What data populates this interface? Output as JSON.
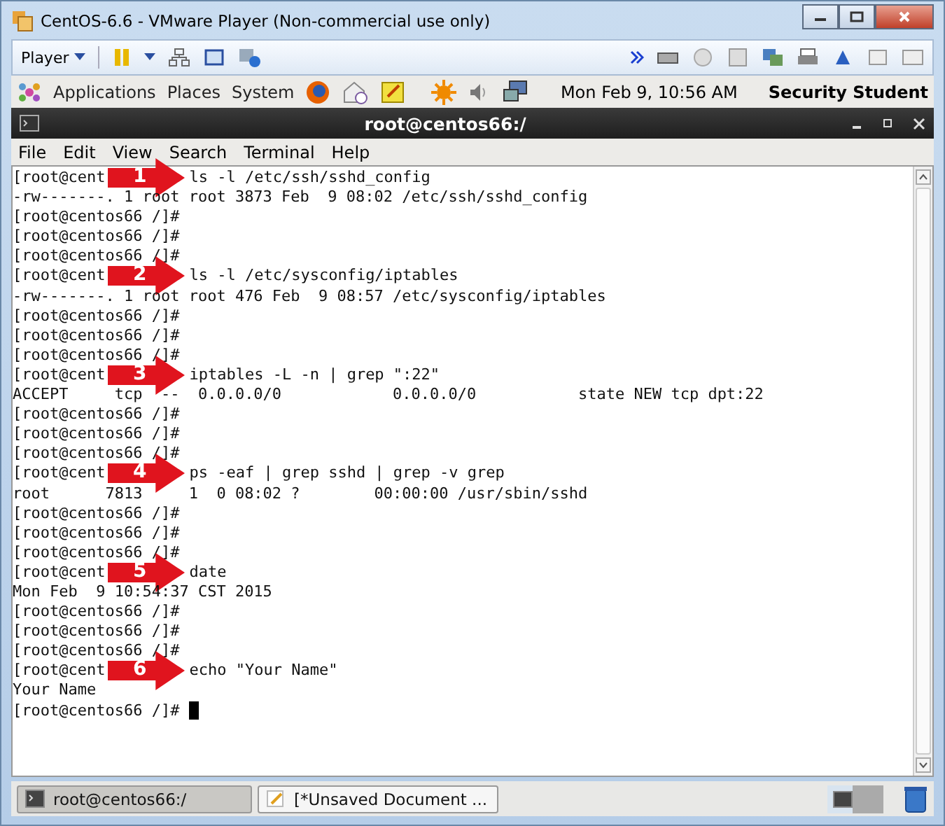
{
  "window": {
    "title": "CentOS-6.6 - VMware Player (Non-commercial use only)"
  },
  "player_toolbar": {
    "menu_label": "Player"
  },
  "panel": {
    "menus": [
      "Applications",
      "Places",
      "System"
    ],
    "clock": "Mon Feb  9, 10:56 AM",
    "user": "Security Student"
  },
  "terminal": {
    "title": "root@centos66:/",
    "menu": [
      "File",
      "Edit",
      "View",
      "Search",
      "Terminal",
      "Help"
    ],
    "lines": [
      {
        "kind": "marked",
        "prefix": "[root@cent",
        "marker": "1",
        "text": "ls -l /etc/ssh/sshd_config"
      },
      {
        "kind": "plain",
        "text": "-rw-------. 1 root root 3873 Feb  9 08:02 /etc/ssh/sshd_config"
      },
      {
        "kind": "plain",
        "text": "[root@centos66 /]#"
      },
      {
        "kind": "plain",
        "text": "[root@centos66 /]#"
      },
      {
        "kind": "plain",
        "text": "[root@centos66 /]#"
      },
      {
        "kind": "marked",
        "prefix": "[root@cent",
        "marker": "2",
        "text": "ls -l /etc/sysconfig/iptables"
      },
      {
        "kind": "plain",
        "text": "-rw-------. 1 root root 476 Feb  9 08:57 /etc/sysconfig/iptables"
      },
      {
        "kind": "plain",
        "text": "[root@centos66 /]#"
      },
      {
        "kind": "plain",
        "text": "[root@centos66 /]#"
      },
      {
        "kind": "plain",
        "text": "[root@centos66 /]#"
      },
      {
        "kind": "marked",
        "prefix": "[root@cent",
        "marker": "3",
        "text": "iptables -L -n | grep \":22\""
      },
      {
        "kind": "plain",
        "text": "ACCEPT     tcp  --  0.0.0.0/0            0.0.0.0/0           state NEW tcp dpt:22"
      },
      {
        "kind": "plain",
        "text": "[root@centos66 /]#"
      },
      {
        "kind": "plain",
        "text": "[root@centos66 /]#"
      },
      {
        "kind": "plain",
        "text": "[root@centos66 /]#"
      },
      {
        "kind": "marked",
        "prefix": "[root@cent",
        "marker": "4",
        "text": "ps -eaf | grep sshd | grep -v grep"
      },
      {
        "kind": "plain",
        "text": "root      7813     1  0 08:02 ?        00:00:00 /usr/sbin/sshd"
      },
      {
        "kind": "plain",
        "text": "[root@centos66 /]#"
      },
      {
        "kind": "plain",
        "text": "[root@centos66 /]#"
      },
      {
        "kind": "plain",
        "text": "[root@centos66 /]#"
      },
      {
        "kind": "marked",
        "prefix": "[root@cent",
        "marker": "5",
        "text": "date"
      },
      {
        "kind": "plain",
        "text": "Mon Feb  9 10:54:37 CST 2015"
      },
      {
        "kind": "plain",
        "text": "[root@centos66 /]#"
      },
      {
        "kind": "plain",
        "text": "[root@centos66 /]#"
      },
      {
        "kind": "plain",
        "text": "[root@centos66 /]#"
      },
      {
        "kind": "marked",
        "prefix": "[root@cent",
        "marker": "6",
        "text": "echo \"Your Name\""
      },
      {
        "kind": "plain",
        "text": "Your Name"
      },
      {
        "kind": "cursor",
        "text": "[root@centos66 /]#"
      }
    ]
  },
  "taskbar": {
    "tasks": [
      {
        "label": "root@centos66:/",
        "kind": "terminal",
        "selected": true
      },
      {
        "label": "[*Unsaved Document ...",
        "kind": "editor",
        "selected": false
      }
    ]
  }
}
